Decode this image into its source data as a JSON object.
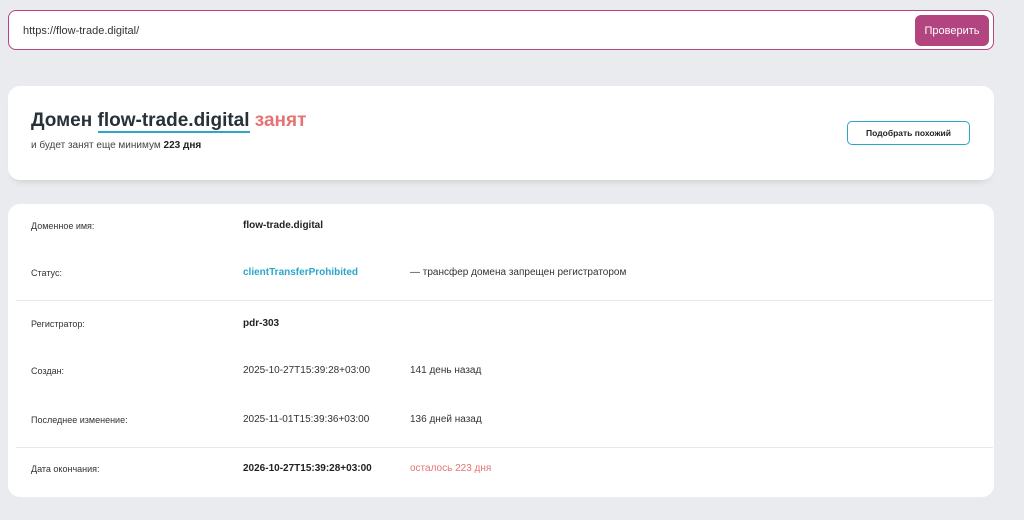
{
  "search": {
    "value": "https://flow-trade.digital/",
    "button_label": "Проверить"
  },
  "result": {
    "prefix": "Домен",
    "domain": "flow-trade.digital",
    "status_word": "занят",
    "subtitle_prefix": "и будет занят еще минимум",
    "days_remaining": "223 дня",
    "similar_button_label": "Подобрать похожий"
  },
  "info": {
    "rows": [
      {
        "label": "Доменное имя:",
        "value": "flow-trade.digital",
        "extra": ""
      },
      {
        "label": "Статус:",
        "value": "clientTransferProhibited",
        "extra": "— трансфер домена запрещен регистратором"
      },
      {
        "label": "Регистратор:",
        "value": "pdr-303",
        "extra": ""
      },
      {
        "label": "Создан:",
        "value": "2025-10-27T15:39:28+03:00",
        "extra": "141 день назад"
      },
      {
        "label": "Последнее изменение:",
        "value": "2025-11-01T15:39:36+03:00",
        "extra": "136 дней назад"
      },
      {
        "label": "Дата окончания:",
        "value": "2026-10-27T15:39:28+03:00",
        "extra": "осталось 223 дня"
      }
    ]
  },
  "colors": {
    "accent": "#b2457f",
    "link": "#2aa7c9",
    "taken": "#e57373",
    "background": "#e9ebee"
  }
}
